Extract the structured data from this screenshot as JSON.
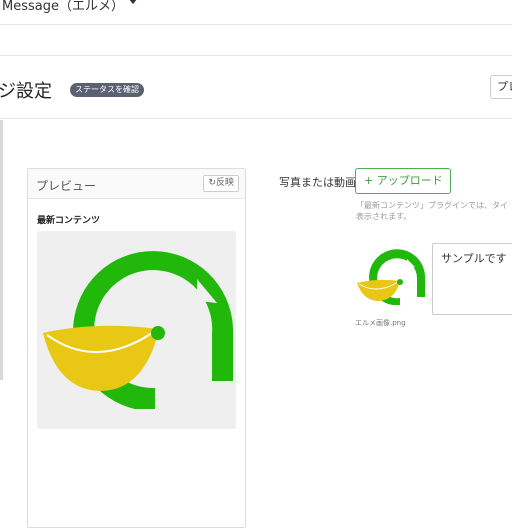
{
  "topbar": {
    "title": "Message（エルメ）"
  },
  "header": {
    "page_title": "ジ設定",
    "status_badge": "ステータスを確認",
    "preview_button": "プレ"
  },
  "preview": {
    "title": "プレビュー",
    "reflect_button": "↻反映",
    "latest_label": "最新コンテンツ"
  },
  "media": {
    "label": "写真または動画",
    "upload_button": "+ アップロード",
    "note_line1": "「最新コンテンツ」プラグインでは、タイ",
    "note_line2": "表示されます。",
    "thumb_caption": "エルメ画像.png",
    "sample_text": "サンプルです"
  },
  "colors": {
    "logo_green": "#21b80b",
    "banana_yellow": "#e8c814",
    "badge_bg": "#5b6170",
    "upload_border": "#4caf50"
  },
  "icons": {
    "caret": "chevron-down-icon",
    "reflect": "refresh-icon"
  }
}
